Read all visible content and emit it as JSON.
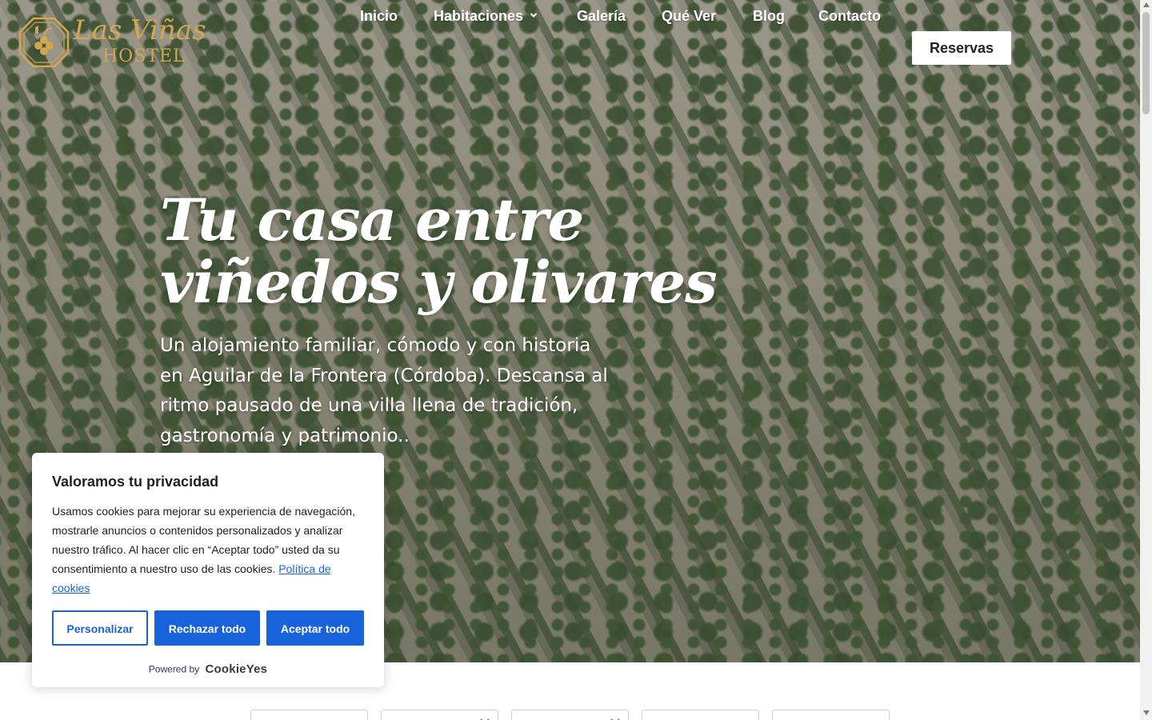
{
  "logo": {
    "name": "Las Viñas",
    "subtitle": "HOSTEL"
  },
  "nav": {
    "items": [
      {
        "label": "Inicio"
      },
      {
        "label": "Habitaciones",
        "has_dropdown": true
      },
      {
        "label": "Galería"
      },
      {
        "label": "Qué Ver"
      },
      {
        "label": "Blog"
      },
      {
        "label": "Contacto"
      }
    ],
    "cta": "Reservas"
  },
  "hero": {
    "title_line1": "Tu casa entre",
    "title_line2": "viñedos y olivares",
    "subtitle": "Un alojamiento familiar, cómodo y con historia en Aguilar de la Frontera (Córdoba). Descansa al ritmo pausado de una villa llena de tradición, gastronomía y patrimonio.."
  },
  "cookie_banner": {
    "title": "Valoramos tu privacidad",
    "text": "Usamos cookies para mejorar su experiencia de navegación, mostrarle anuncios o contenidos personalizados y analizar nuestro tráfico. Al hacer clic en “Aceptar todo” usted da su consentimiento a nuestro uso de las cookies.",
    "policy_link": "Política de cookies",
    "buttons": {
      "customize": "Personalizar",
      "reject": "Rechazar todo",
      "accept": "Aceptar todo"
    },
    "powered_by": "Powered by",
    "brand": "CookieYes"
  },
  "colors": {
    "logo_gold": "#d3a651",
    "cookie_blue": "#1863dc",
    "nav_text": "#ffffff"
  },
  "icons": {
    "dropdown": "chevron-down-icon",
    "logo": "grape-emblem-icon"
  }
}
